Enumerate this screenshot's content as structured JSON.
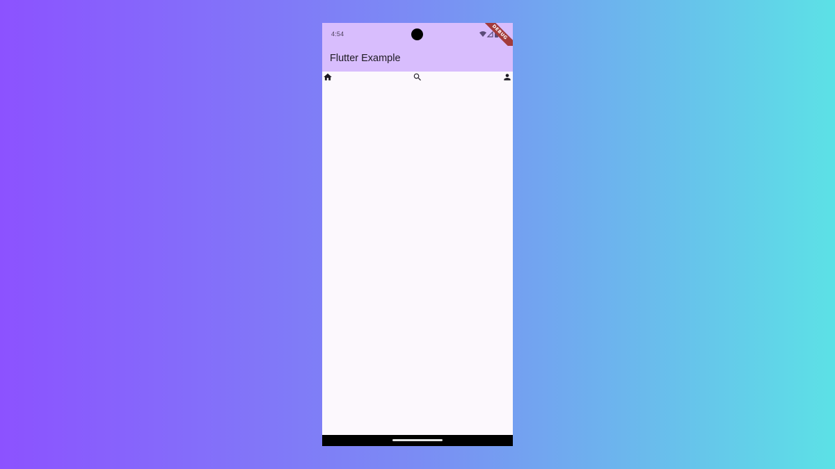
{
  "status_bar": {
    "time": "4:54",
    "icons": [
      "wifi-icon",
      "signal-icon",
      "battery-icon"
    ]
  },
  "app_bar": {
    "title": "Flutter Example",
    "background_color": "#d8bdfd"
  },
  "debug_banner": {
    "label": "DEBUG",
    "color": "#a33b3b"
  },
  "tabs": [
    {
      "icon": "home-icon"
    },
    {
      "icon": "search-icon"
    },
    {
      "icon": "person-icon"
    }
  ],
  "colors": {
    "gradient_start": "#8c52ff",
    "gradient_end": "#5ce1e6",
    "surface": "#fcf8fd"
  }
}
